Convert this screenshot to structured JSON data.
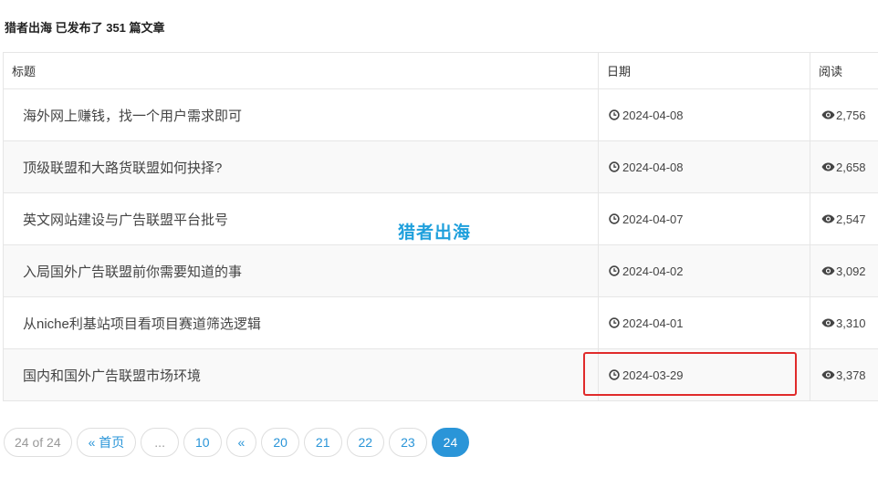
{
  "summary": "猎者出海 已发布了 351 篇文章",
  "table": {
    "headers": {
      "title": "标题",
      "date": "日期",
      "views": "阅读"
    },
    "rows": [
      {
        "title": "海外网上赚钱，找一个用户需求即可",
        "date": "2024-04-08",
        "views": "2,756"
      },
      {
        "title": "顶级联盟和大路货联盟如何抉择?",
        "date": "2024-04-08",
        "views": "2,658"
      },
      {
        "title": "英文网站建设与广告联盟平台批号",
        "date": "2024-04-07",
        "views": "2,547"
      },
      {
        "title": "入局国外广告联盟前你需要知道的事",
        "date": "2024-04-02",
        "views": "3,092"
      },
      {
        "title": "从niche利基站项目看项目赛道筛选逻辑",
        "date": "2024-04-01",
        "views": "3,310"
      },
      {
        "title": "国内和国外广告联盟市场环境",
        "date": "2024-03-29",
        "views": "3,378"
      }
    ]
  },
  "watermark": "猎者出海",
  "pagination": {
    "info": "24 of 24",
    "first": "« 首页",
    "ellipsis": "...",
    "p10": "10",
    "prev": "«",
    "p20": "20",
    "p21": "21",
    "p22": "22",
    "p23": "23",
    "current": "24"
  },
  "icons": {
    "date": "clock-icon",
    "views": "eye-icon"
  },
  "colors": {
    "accent": "#2a95d8",
    "highlight": "#e02b2b",
    "watermark": "#1fa0dc"
  }
}
